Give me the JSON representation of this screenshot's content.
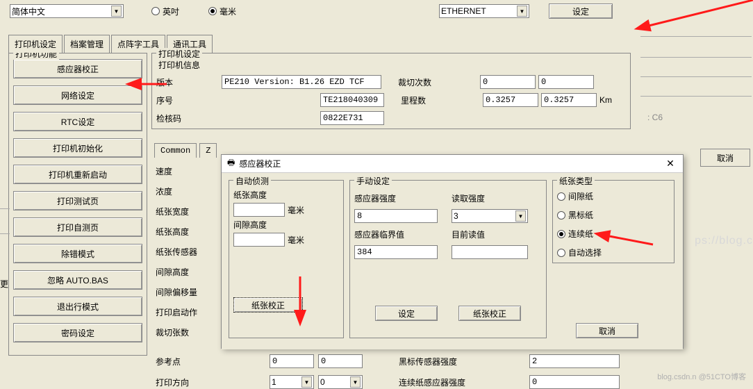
{
  "top": {
    "language": "简体中文",
    "unit_inch": "英吋",
    "unit_mm": "毫米",
    "interface": "ETHERNET",
    "set_btn": "设定"
  },
  "tabs": {
    "printer": "打印机设定",
    "file": "档案管理",
    "font": "点阵字工具",
    "comm": "通讯工具"
  },
  "left": {
    "legend": "打印机功能",
    "items": [
      "感应器校正",
      "网络设定",
      "RTC设定",
      "打印机初始化",
      "打印机重新启动",
      "打印测试页",
      "打印自测页",
      "除错模式",
      "忽略 AUTO.BAS",
      "退出行模式",
      "密码设定"
    ]
  },
  "info": {
    "legend1": "打印机设定",
    "legend2": "打印机信息",
    "version_lbl": "版本",
    "version_val": "PE210 Version: B1.26 EZD TCF",
    "serial_lbl": "序号",
    "serial_val": "TE218040309",
    "check_lbl": "检核码",
    "check_val": "0822E731",
    "cut_lbl": "裁切次数",
    "cut_v1": "0",
    "cut_v2": "0",
    "mile_lbl": "里程数",
    "mile_v1": "0.3257",
    "mile_v2": "0.3257",
    "km": "Km"
  },
  "subtabs": {
    "common": "Common",
    "z": "Z"
  },
  "labels": [
    "速度",
    "浓度",
    "纸张宽度",
    "纸张高度",
    "纸张传感器",
    "间隙高度",
    "间隙偏移量",
    "打印启动作",
    "裁切张数"
  ],
  "bottom": {
    "ref_lbl": "参考点",
    "ref_v1": "0",
    "ref_v2": "0",
    "black_lbl": "黑标传感器强度",
    "black_v": "2",
    "dir_lbl": "打印方向",
    "dir_v1": "1",
    "dir_v2": "0",
    "cont_lbl": "连续纸感应器强度",
    "cont_v": "0"
  },
  "dialog": {
    "title": "感应器校正",
    "auto": {
      "legend": "自动侦测",
      "h_lbl": "纸张高度",
      "g_lbl": "间隙高度",
      "mm": "毫米",
      "btn": "纸张校正"
    },
    "manual": {
      "legend": "手动设定",
      "sens_lbl": "感应器强度",
      "sens_v": "8",
      "read_lbl": "读取强度",
      "read_v": "3",
      "thresh_lbl": "感应器临界值",
      "thresh_v": "384",
      "cur_lbl": "目前读值",
      "set_btn": "设定",
      "cal_btn": "纸张校正"
    },
    "paper": {
      "legend": "纸张类型",
      "gap": "间隙纸",
      "black": "黑标纸",
      "cont": "连续纸",
      "auto": "自动选择"
    },
    "cancel": "取消"
  },
  "side": {
    "cancel": "取消",
    "c6": ": C6"
  },
  "partial": "更",
  "wm_right": "ps://blog.c",
  "wm_bottom": "blog.csdn.n  @51CTO博客"
}
